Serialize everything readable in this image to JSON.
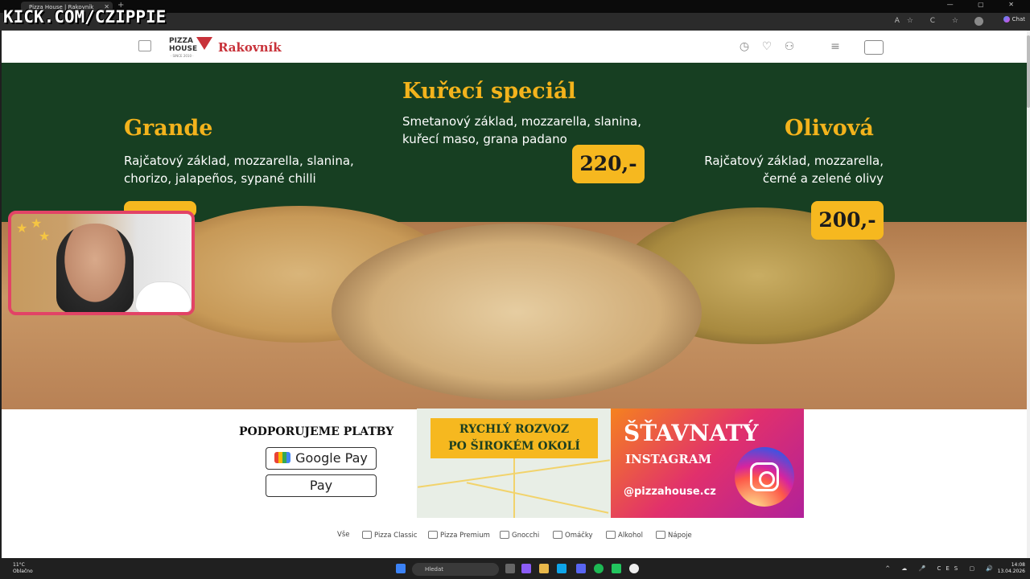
{
  "browser": {
    "tab_title": "Pizza House | Rakovník",
    "tab_close": "✕",
    "new_tab": "+",
    "window_controls": "—  ▢  ✕",
    "toolbar_icons": "A☆ C ☆",
    "chat_label": "Chat"
  },
  "stream_overlay": {
    "channel": "KICK.COM/CZIPPIE"
  },
  "site_header": {
    "logo_line1": "PIZZA",
    "logo_line2": "HOUSE",
    "logo_since": "· SINCE 2010 ·",
    "city": "Rakovník",
    "icons": [
      "clock-icon",
      "heart-icon",
      "user-icon",
      "menu-icon",
      "cart-icon"
    ]
  },
  "hero": {
    "pizzas": [
      {
        "title": "Grande",
        "desc": "Rajčatový základ, mozzarella, slanina, chorizo, jalapeños, sypané chilli",
        "price": ""
      },
      {
        "title": "Kuřecí speciál",
        "desc": "Smetanový základ, mozzarella, slanina, kuřecí maso, grana padano",
        "price": "220,-"
      },
      {
        "title": "Olivová",
        "desc": "Rajčatový základ, mozzarella, černé a zelené olivy",
        "price": "200,-"
      }
    ]
  },
  "payments": {
    "title": "PODPORUJEME PLATBY",
    "google_pay": "Google Pay",
    "apple_pay": " Pay"
  },
  "banners": {
    "delivery_line1": "RYCHLÝ ROZVOZ",
    "delivery_line2": "PO ŠIROKÉM OKOLÍ",
    "insta_line1": "ŠŤAVNATÝ",
    "insta_line2": "INSTAGRAM",
    "insta_handle": "@pizzahouse.cz"
  },
  "categories": [
    "Vše",
    "Pizza Classic",
    "Pizza Premium",
    "Gnocchi",
    "Omáčky",
    "Alkohol",
    "Nápoje"
  ],
  "taskbar": {
    "weather_temp": "11°C",
    "weather_desc": "Oblačno",
    "search_placeholder": "Hledat",
    "tray": "^ ☁ 🎤 CES ▢ 🔊",
    "time": "14:08",
    "date": "13.04.2026"
  },
  "colors": {
    "brand_red": "#c8323a",
    "hero_green": "#173f22",
    "price_yellow": "#f6b81f",
    "title_yellow": "#f3b31c"
  }
}
